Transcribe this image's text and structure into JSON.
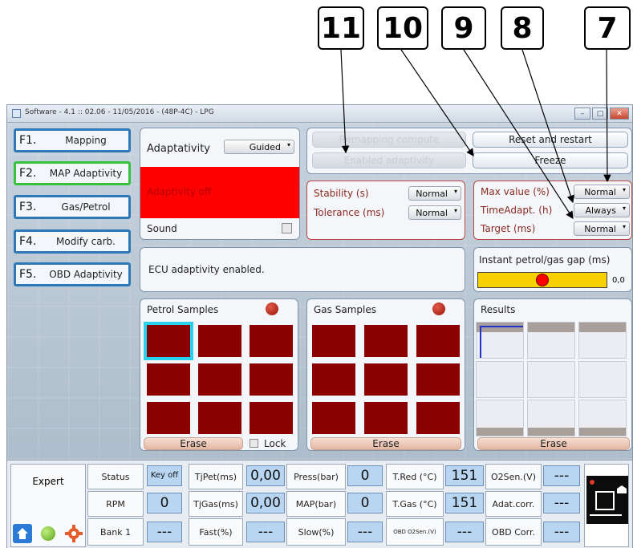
{
  "callouts": [
    "11",
    "10",
    "9",
    "8",
    "7"
  ],
  "window": {
    "title": "Software - 4.1 :: 02.06 - 11/05/2016 - (48P-4C) - LPG",
    "min": "–",
    "max": "□",
    "close": "✕"
  },
  "menu": [
    {
      "key": "F1.",
      "label": "Mapping"
    },
    {
      "key": "F2.",
      "label": "MAP Adaptivity"
    },
    {
      "key": "F3.",
      "label": "Gas/Petrol"
    },
    {
      "key": "F4.",
      "label": "Modify carb."
    },
    {
      "key": "F5.",
      "label": "OBD Adaptivity"
    }
  ],
  "adaptivity": {
    "label": "Adaptativity",
    "mode": "Guided",
    "state": "Adaptivity off",
    "state_color": "#ff0000",
    "sound_label": "Sound"
  },
  "actions": {
    "remap": "Remapping compute",
    "enabled": "Enabled adaptivity",
    "reset": "Reset and restart",
    "freeze": "Freeze"
  },
  "mid_params": {
    "stability_label": "Stability (s)",
    "stability_value": "Normal",
    "tolerance_label": "Tolerance (ms)",
    "tolerance_value": "Normal"
  },
  "right_params": {
    "max_label": "Max value (%)",
    "max_value": "Normal",
    "time_label": "TimeAdapt. (h)",
    "time_value": "Always",
    "target_label": "Target (ms)",
    "target_value": "Normal"
  },
  "message": "ECU adaptivity enabled.",
  "gap": {
    "label": "Instant petrol/gas gap (ms)",
    "value": "0,0",
    "bar_color": "#f6d000"
  },
  "petrol": {
    "title": "Petrol Samples",
    "erase": "Erase",
    "lock": "Lock"
  },
  "gas": {
    "title": "Gas Samples",
    "erase": "Erase"
  },
  "results": {
    "title": "Results",
    "erase": "Erase"
  },
  "status": {
    "expert": "Expert",
    "row1": [
      {
        "label": "Status",
        "value": "Key off"
      },
      {
        "label": "TjPet(ms)",
        "value": "0,00"
      },
      {
        "label": "Press(bar)",
        "value": "0"
      },
      {
        "label": "T.Red (°C)",
        "value": "151"
      },
      {
        "label": "O2Sen.(V)",
        "value": "---"
      }
    ],
    "row2": [
      {
        "label": "RPM",
        "value": "0"
      },
      {
        "label": "TjGas(ms)",
        "value": "0,00"
      },
      {
        "label": "MAP(bar)",
        "value": "0"
      },
      {
        "label": "T.Gas (°C)",
        "value": "151"
      },
      {
        "label": "Adat.corr.",
        "value": "---"
      }
    ],
    "row3": [
      {
        "label": "Bank 1",
        "value": "---"
      },
      {
        "label": "Fast(%)",
        "value": "---"
      },
      {
        "label": "Slow(%)",
        "value": "---"
      },
      {
        "label": "OBD O2Sen.(V)",
        "value": "---"
      },
      {
        "label": "OBD Corr.",
        "value": "---"
      }
    ]
  }
}
